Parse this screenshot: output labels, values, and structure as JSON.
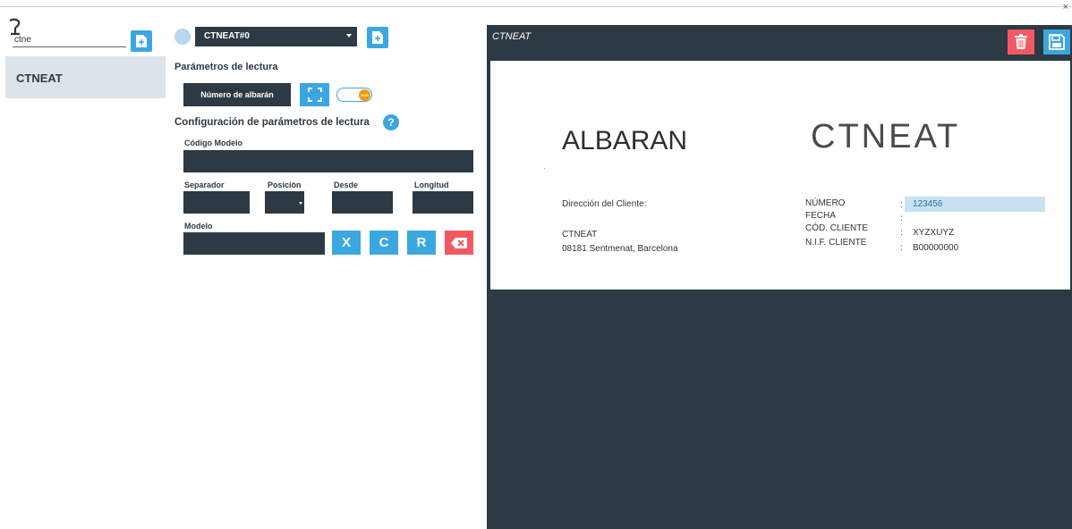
{
  "window": {
    "close_glyph": "×"
  },
  "left": {
    "search_icon": "search-icon",
    "search_value": "ctne",
    "list_items": [
      "CTNEAT"
    ]
  },
  "middle": {
    "selected_model": "CTNEAT#0",
    "section_reading": "Parámetros de lectura",
    "albaran_button": "Número de albarán",
    "ocr_toggle_label": "OCR",
    "ocr_enabled": true,
    "section_config": "Configuración de parámetros de lectura",
    "help_glyph": "?",
    "codigo_modelo_label": "Código Modelo",
    "separador_label": "Separador",
    "posicion_label": "Posición",
    "desde_label": "Desde",
    "longitud_label": "Longitud",
    "modelo_label": "Modelo",
    "btn_x": "X",
    "btn_c": "C",
    "btn_r": "R"
  },
  "pane": {
    "title": "CTNEAT",
    "document": {
      "heading": "ALBARAN",
      "logo": "CTNEAT",
      "client_address_label": "Dirección del Cliente:",
      "client_name": "CTNEAT",
      "client_address": "08181 Sentmenat, Barcelona",
      "fields": [
        {
          "label": "NÚMERO",
          "sep": ":",
          "value": "123456"
        },
        {
          "label": "FECHA",
          "sep": ":",
          "value": ""
        },
        {
          "label": "CÓD. CLIENTE",
          "sep": ":",
          "value": "XYZXUYZ"
        },
        {
          "label": "N.I.F. CLIENTE",
          "sep": ":",
          "value": "B00000000"
        }
      ]
    }
  },
  "colors": {
    "accent_blue": "#3ba7e0",
    "dark": "#2d3a44",
    "danger": "#f25a63",
    "ocr_orange": "#f29a0e"
  }
}
